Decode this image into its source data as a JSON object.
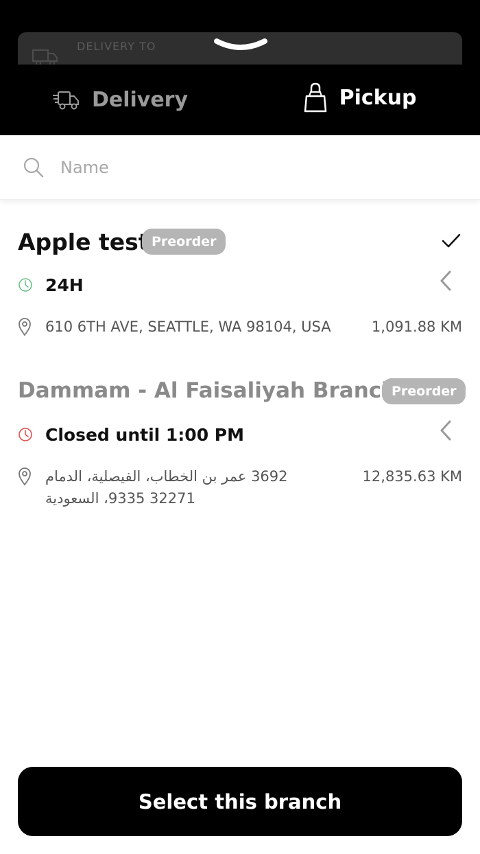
{
  "peek": {
    "label": "DELIVERY TO"
  },
  "tabs": [
    {
      "label": "Delivery",
      "icon": "delivery-truck-icon",
      "active": false
    },
    {
      "label": "Pickup",
      "icon": "shopping-bag-icon",
      "active": true
    }
  ],
  "search": {
    "placeholder": "Name",
    "value": ""
  },
  "branches": [
    {
      "name": "Apple test",
      "badge": "Preorder",
      "status": "24H",
      "status_color": "#6fc18a",
      "address": "610 6TH AVE, SEATTLE, WA 98104, USA",
      "distance": "1,091.88 KM",
      "selected": true
    },
    {
      "name": "Dammam - Al Faisaliyah Branch",
      "badge": "Preorder",
      "status": "Closed until 1:00 PM",
      "status_color": "#e0524f",
      "address": "3692 عمر بن الخطاب، الفيصلية، الدمام 32271 9335، السعودية",
      "distance": "12,835.63 KM",
      "selected": false
    }
  ],
  "cta": {
    "label": "Select this branch"
  },
  "colors": {
    "dark": "#000000",
    "badge": "#b5b5b5",
    "muted_text": "#8a8a8a"
  }
}
